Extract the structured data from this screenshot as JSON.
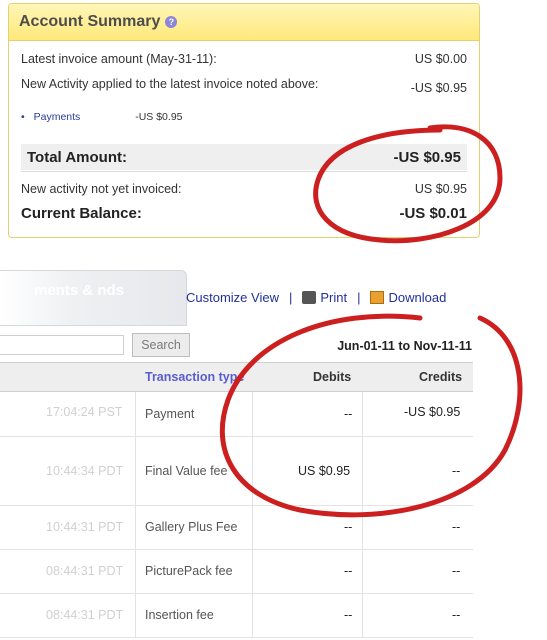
{
  "summary": {
    "title": "Account Summary",
    "help_icon": "?",
    "latest_invoice_label": "Latest invoice amount (May-31-11):",
    "latest_invoice_value": "US $0.00",
    "new_activity_label": "New Activity applied to the latest invoice noted above:",
    "new_activity_value": "-US $0.95",
    "payments_label": "Payments",
    "payments_value": "-US $0.95",
    "total_label": "Total Amount:",
    "total_value": "-US $0.95",
    "not_invoiced_label": "New activity not yet invoiced:",
    "not_invoiced_value": "US $0.95",
    "balance_label": "Current Balance:",
    "balance_value": "-US $0.01"
  },
  "tab": {
    "text": "ments & nds"
  },
  "actions": {
    "customize": "Customize View",
    "sep": "|",
    "print": "Print",
    "download": "Download"
  },
  "search": {
    "button": "Search",
    "date_range": "Jun-01-11 to Nov-11-11"
  },
  "table": {
    "headers": {
      "type": "Transaction type",
      "debits": "Debits",
      "credits": "Credits"
    },
    "rows": [
      {
        "time": "17:04:24 PST",
        "type": "Payment",
        "debit": "--",
        "credit": "-US $0.95"
      },
      {
        "time": "10:44:34 PDT",
        "type": "Final Value fee",
        "debit": "US $0.95",
        "credit": "--"
      },
      {
        "time": "10:44:31 PDT",
        "type": "Gallery Plus Fee",
        "debit": "--",
        "credit": "--"
      },
      {
        "time": "08:44:31 PDT",
        "type": "PicturePack fee",
        "debit": "--",
        "credit": "--"
      },
      {
        "time": "08:44:31 PDT",
        "type": "Insertion fee",
        "debit": "--",
        "credit": "--"
      }
    ]
  },
  "colors": {
    "accent_link": "#23309a",
    "annotation_red": "#cc1f1f",
    "header_yellow": "#ffe97a"
  }
}
